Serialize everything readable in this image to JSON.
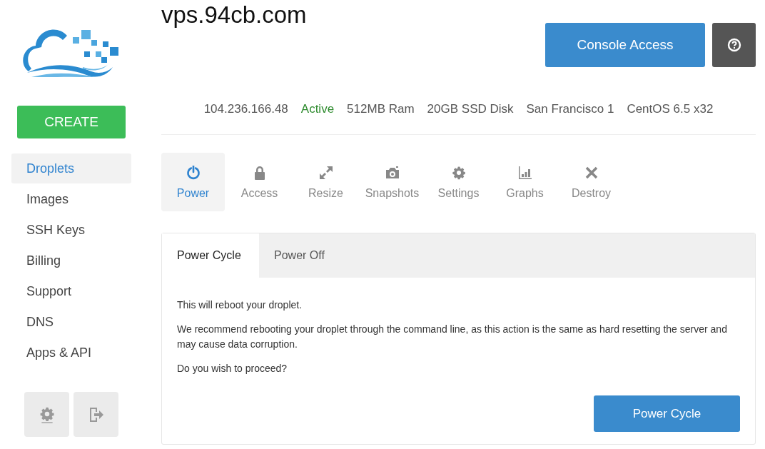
{
  "sidebar": {
    "create_button": "CREATE",
    "items": [
      {
        "label": "Droplets",
        "selected": true
      },
      {
        "label": "Images",
        "selected": false
      },
      {
        "label": "SSH Keys",
        "selected": false
      },
      {
        "label": "Billing",
        "selected": false
      },
      {
        "label": "Support",
        "selected": false
      },
      {
        "label": "DNS",
        "selected": false
      },
      {
        "label": "Apps & API",
        "selected": false
      }
    ]
  },
  "header": {
    "title": "vps.94cb.com",
    "console_button": "Console Access"
  },
  "info": [
    {
      "text": "104.236.166.48",
      "kind": "plain"
    },
    {
      "text": "Active",
      "kind": "status"
    },
    {
      "text": "512MB Ram",
      "kind": "plain"
    },
    {
      "text": "20GB SSD Disk",
      "kind": "plain"
    },
    {
      "text": "San Francisco 1",
      "kind": "plain"
    },
    {
      "text": "CentOS 6.5 x32",
      "kind": "plain"
    }
  ],
  "actions": [
    {
      "label": "Power",
      "selected": true
    },
    {
      "label": "Access",
      "selected": false
    },
    {
      "label": "Resize",
      "selected": false
    },
    {
      "label": "Snapshots",
      "selected": false
    },
    {
      "label": "Settings",
      "selected": false
    },
    {
      "label": "Graphs",
      "selected": false
    },
    {
      "label": "Destroy",
      "selected": false
    }
  ],
  "panel": {
    "tabs": [
      {
        "label": "Power Cycle",
        "selected": true
      },
      {
        "label": "Power Off",
        "selected": false
      }
    ],
    "paragraphs": [
      "This will reboot your droplet.",
      "We recommend rebooting your droplet through the command line, as this action is the same as hard resetting the server and may cause data corruption.",
      "Do you wish to proceed?"
    ],
    "button": "Power Cycle"
  }
}
